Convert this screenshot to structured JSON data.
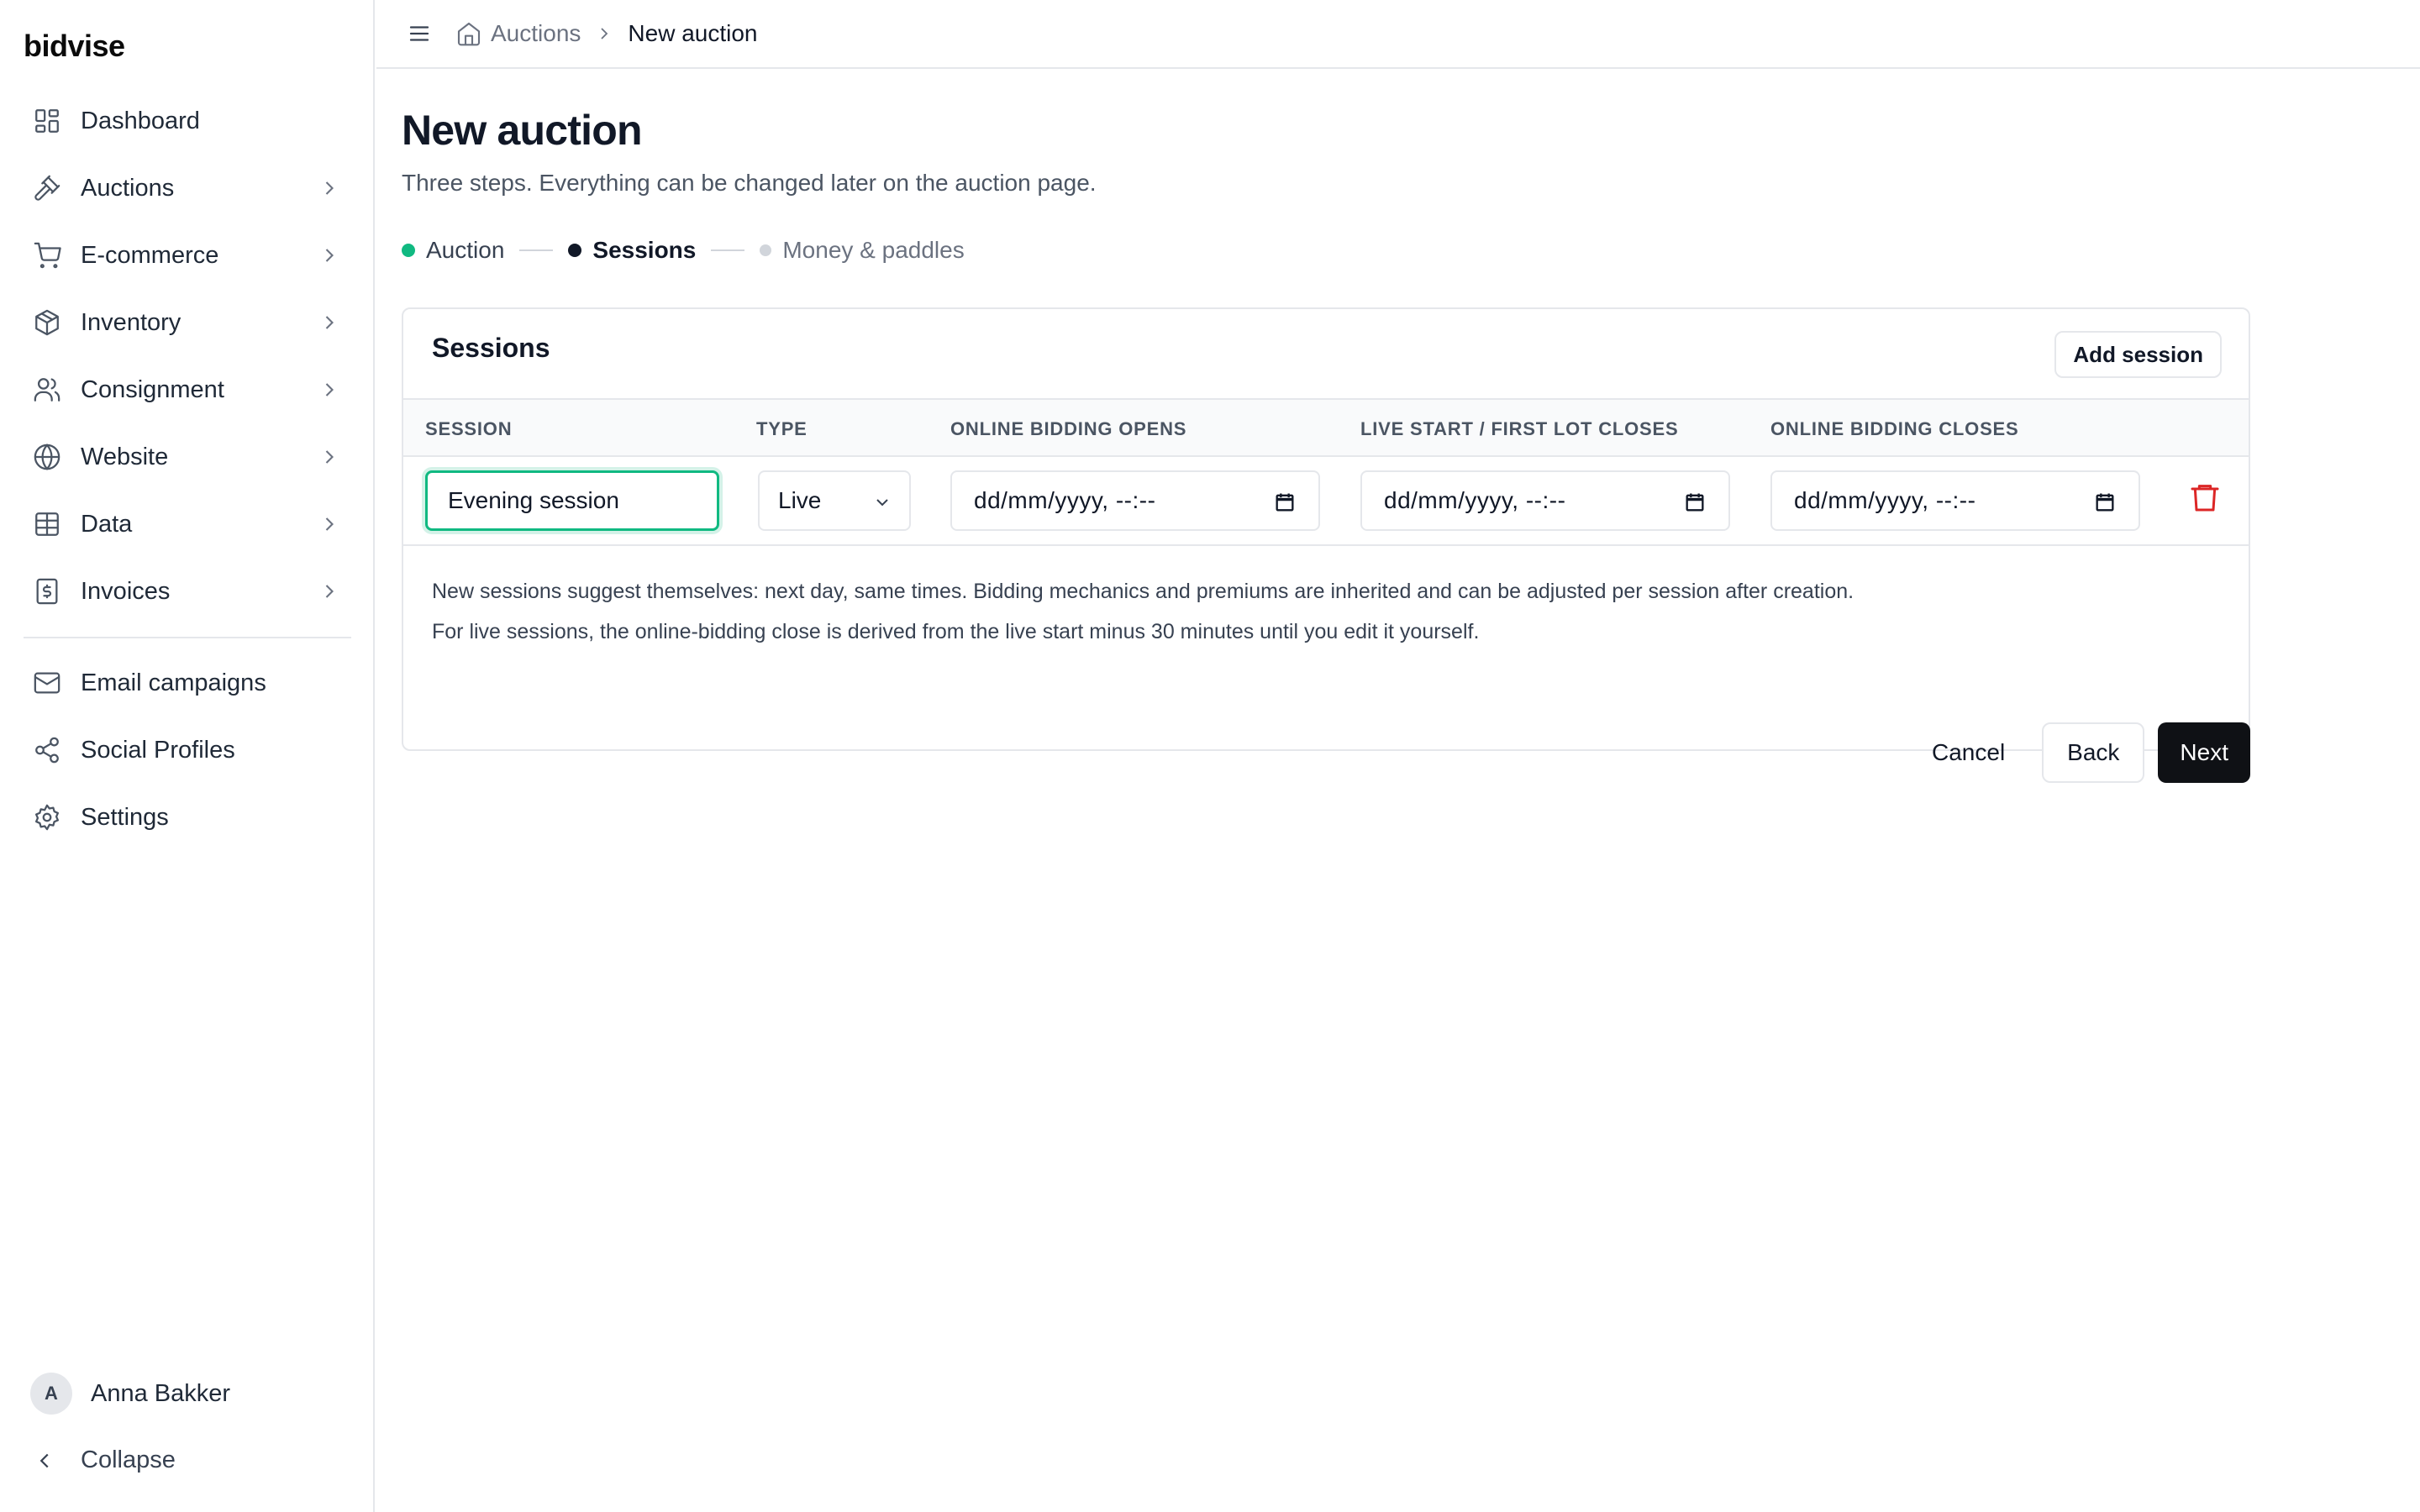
{
  "app": {
    "logo": "bidvise"
  },
  "sidebar": {
    "items": [
      {
        "label": "Dashboard",
        "icon": "dashboard-icon",
        "has_children": false
      },
      {
        "label": "Auctions",
        "icon": "gavel-icon",
        "has_children": true
      },
      {
        "label": "E-commerce",
        "icon": "cart-icon",
        "has_children": true
      },
      {
        "label": "Inventory",
        "icon": "package-icon",
        "has_children": true
      },
      {
        "label": "Consignment",
        "icon": "users-icon",
        "has_children": true
      },
      {
        "label": "Website",
        "icon": "globe-icon",
        "has_children": true
      },
      {
        "label": "Data",
        "icon": "table-icon",
        "has_children": true
      },
      {
        "label": "Invoices",
        "icon": "invoice-icon",
        "has_children": true
      }
    ],
    "secondary": [
      {
        "label": "Email campaigns",
        "icon": "mail-icon"
      },
      {
        "label": "Social Profiles",
        "icon": "share-icon"
      },
      {
        "label": "Settings",
        "icon": "gear-icon"
      }
    ],
    "user": {
      "initial": "A",
      "name": "Anna Bakker"
    },
    "collapse_label": "Collapse"
  },
  "breadcrumb": {
    "parent": "Auctions",
    "current": "New auction"
  },
  "page": {
    "title": "New auction",
    "subtitle": "Three steps. Everything can be changed later on the auction page."
  },
  "steps": [
    {
      "label": "Auction",
      "state": "done"
    },
    {
      "label": "Sessions",
      "state": "current"
    },
    {
      "label": "Money & paddles",
      "state": "upcoming"
    }
  ],
  "sessions_card": {
    "title": "Sessions",
    "add_button": "Add session",
    "columns": [
      "SESSION",
      "TYPE",
      "ONLINE BIDDING OPENS",
      "LIVE START / FIRST LOT CLOSES",
      "ONLINE BIDDING CLOSES"
    ],
    "rows": [
      {
        "name": "Evening session",
        "type": "Live",
        "online_opens": "dd/mm/yyyy, --:--",
        "live_start": "dd/mm/yyyy, --:--",
        "online_closes": "dd/mm/yyyy, --:--"
      }
    ],
    "notes": [
      "New sessions suggest themselves: next day, same times. Bidding mechanics and premiums are inherited and can be adjusted per session after creation.",
      "For live sessions, the online-bidding close is derived from the live start minus 30 minutes until you edit it yourself."
    ]
  },
  "actions": {
    "cancel": "Cancel",
    "back": "Back",
    "next": "Next"
  },
  "colors": {
    "accent": "#10b981",
    "primary_button": "#0f1115",
    "danger": "#dc2626",
    "step_done": "#10b981",
    "step_current": "#111827",
    "step_upcoming": "#d1d5db"
  }
}
